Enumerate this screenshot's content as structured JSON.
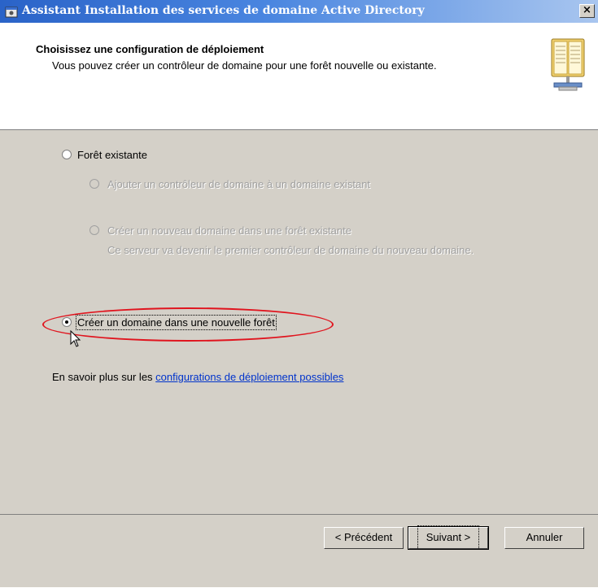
{
  "window": {
    "title": "Assistant Installation des services de domaine Active Directory",
    "close_label": "×"
  },
  "header": {
    "title": "Choisissez une configuration de déploiement",
    "subtitle": "Vous pouvez créer un contrôleur de domaine pour une forêt nouvelle ou existante."
  },
  "options": {
    "existing_forest": {
      "label": "Forêt existante",
      "selected": false,
      "enabled": true
    },
    "add_dc": {
      "label": "Ajouter un contrôleur de domaine à un domaine existant",
      "selected": false,
      "enabled": false
    },
    "new_domain_existing_forest": {
      "label": "Créer un nouveau domaine dans une forêt existante",
      "description": "Ce serveur va devenir le premier contrôleur de domaine du nouveau domaine.",
      "selected": false,
      "enabled": false
    },
    "new_forest": {
      "label": "Créer un domaine dans une nouvelle forêt",
      "selected": true,
      "enabled": true
    }
  },
  "info": {
    "prefix": "En savoir plus sur les ",
    "link_text": "configurations de déploiement possibles"
  },
  "buttons": {
    "back": "< Précédent",
    "next": "Suivant >",
    "cancel": "Annuler"
  },
  "colors": {
    "title_bar": "#2a63c8",
    "dialog_bg": "#d4d0c8",
    "link": "#0033cc",
    "highlight_ellipse": "#e0141e"
  }
}
